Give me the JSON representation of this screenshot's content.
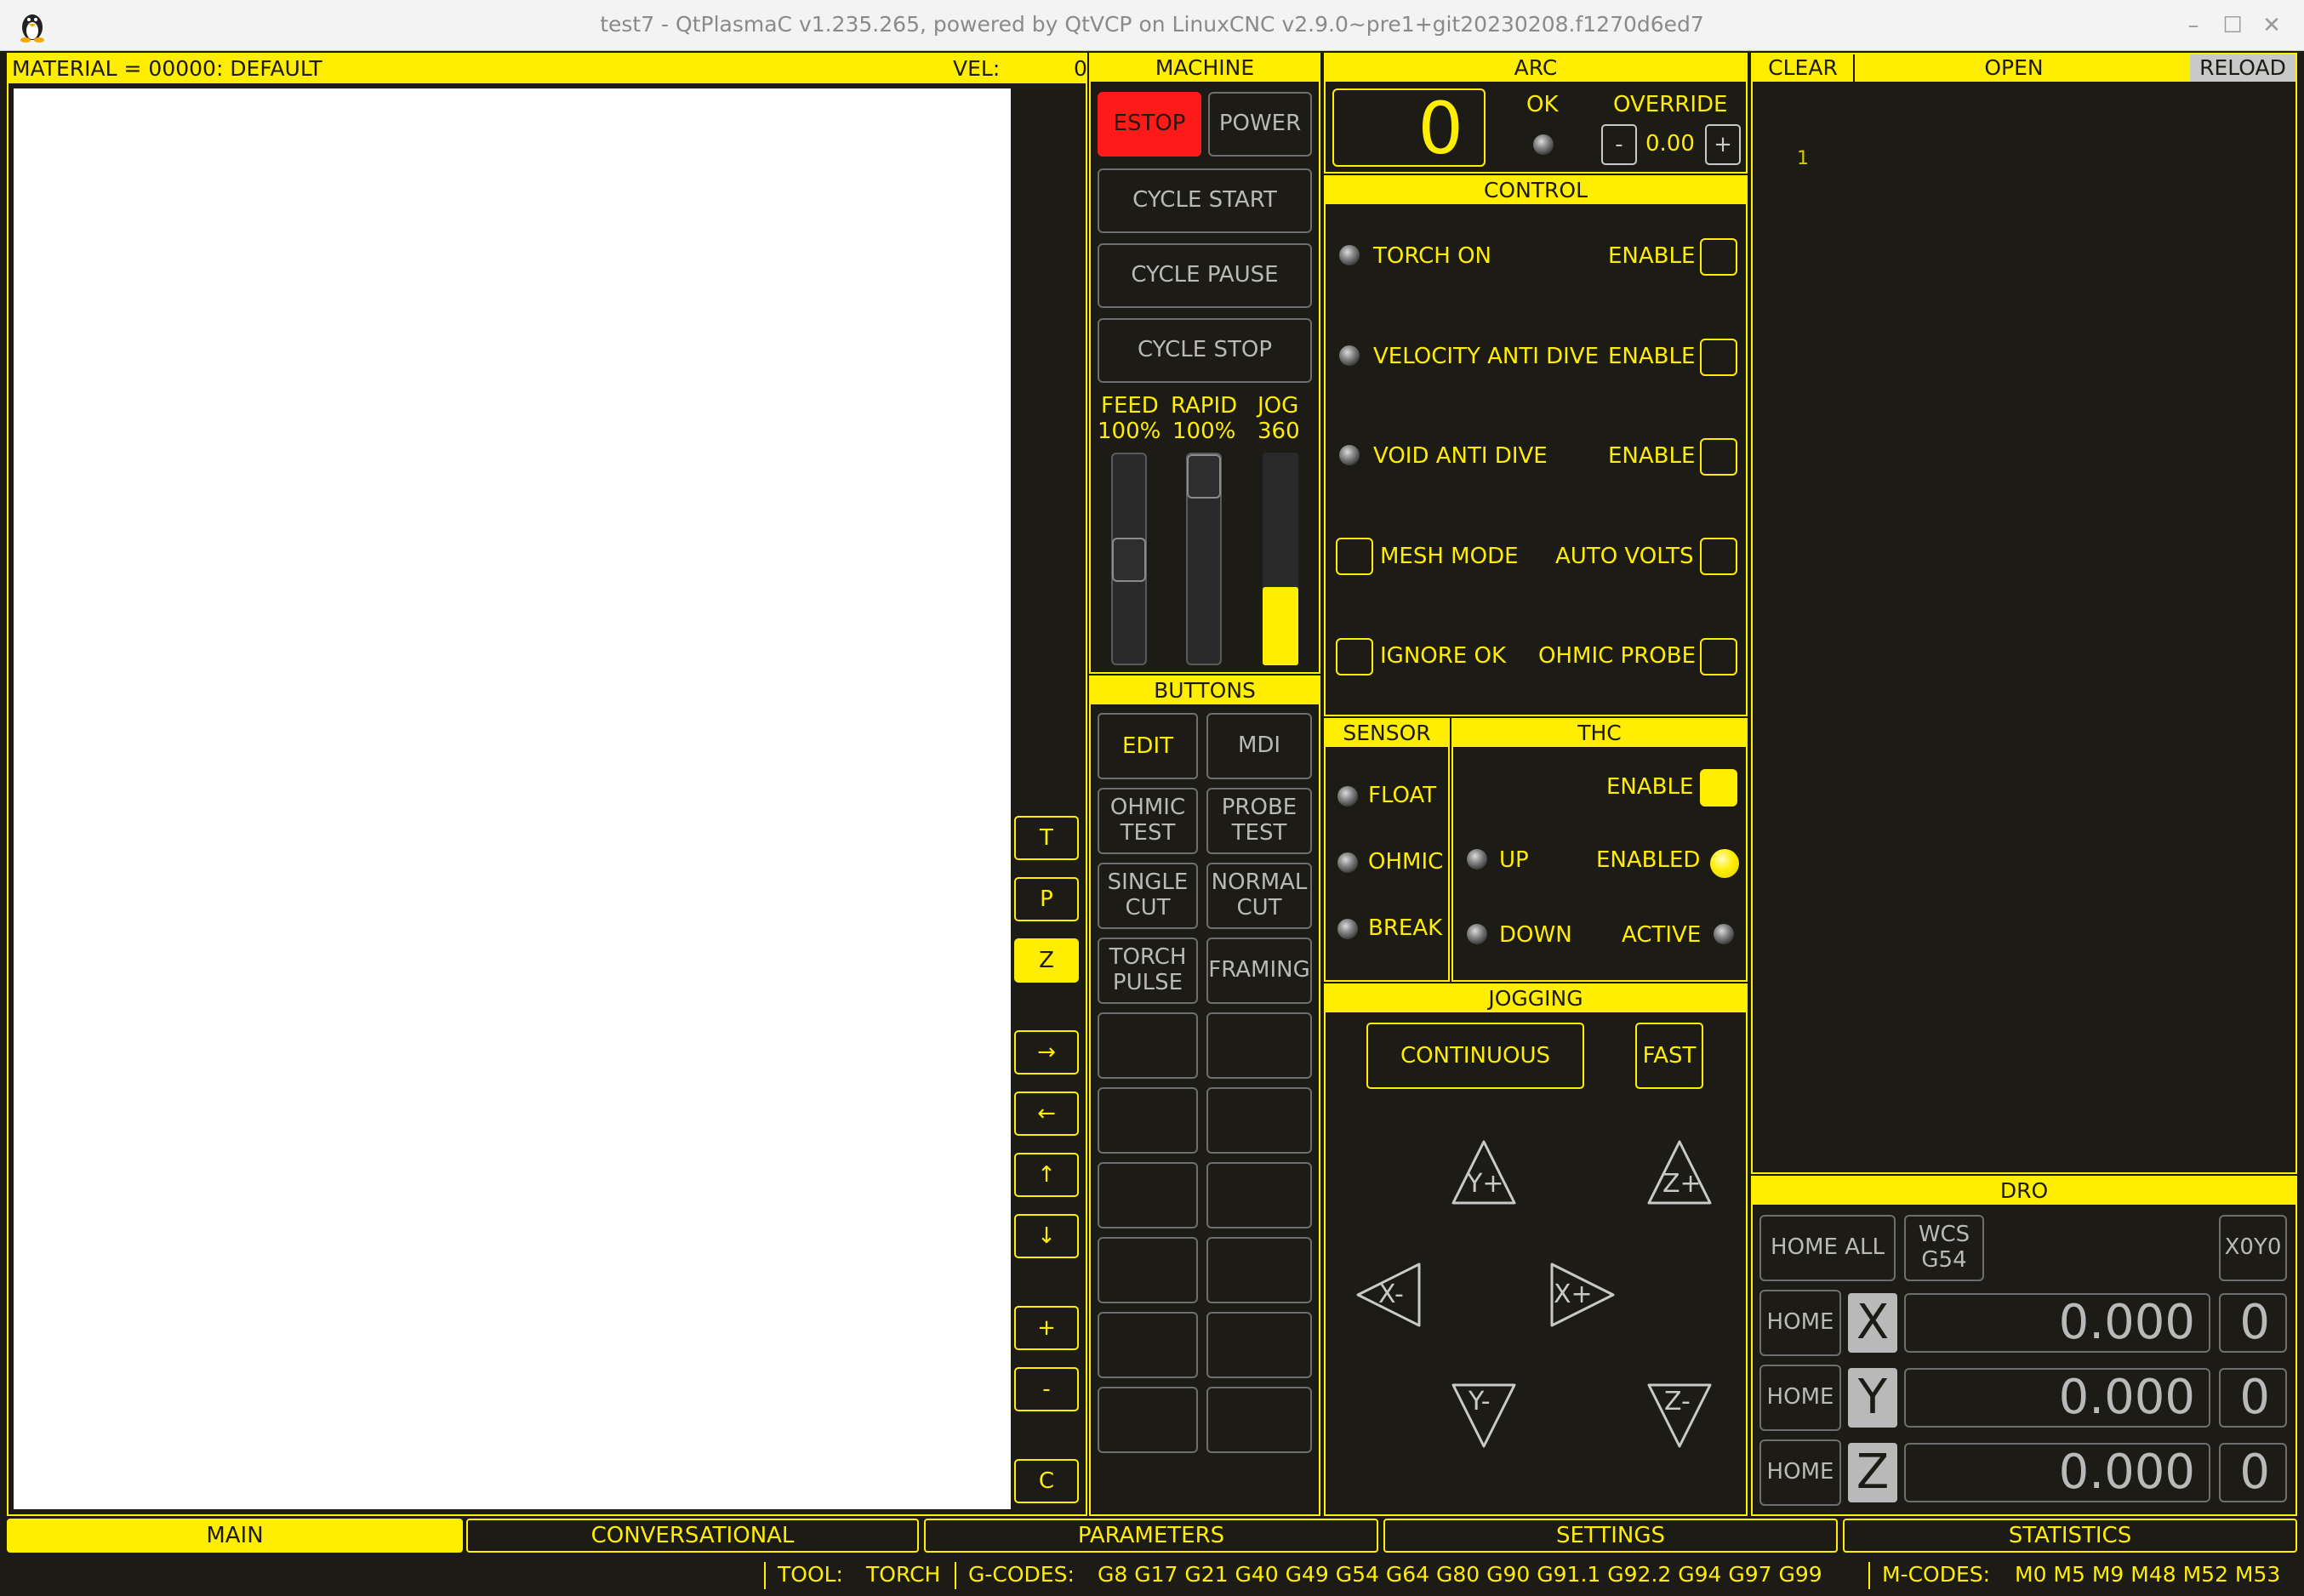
{
  "window": {
    "title": "test7 - QtPlasmaC v1.235.265, powered by QtVCP on LinuxCNC v2.9.0~pre1+git20230208.f1270d6ed7"
  },
  "preview": {
    "material_label": "MATERIAL =  00000: DEFAULT",
    "vel_label": "VEL:",
    "vel_value": "0",
    "view_buttons": [
      "T",
      "P",
      "Z",
      "→",
      "←",
      "↑",
      "↓",
      "+",
      "-",
      "C"
    ]
  },
  "machine": {
    "header": "MACHINE",
    "estop": "ESTOP",
    "power": "POWER",
    "cycle_start": "CYCLE START",
    "cycle_pause": "CYCLE PAUSE",
    "cycle_stop": "CYCLE STOP",
    "feed_label": "FEED",
    "feed_value": "100%",
    "rapid_label": "RAPID",
    "rapid_value": "100%",
    "jog_label": "JOG",
    "jog_value": "360"
  },
  "arc": {
    "header": "ARC",
    "voltage": "0",
    "ok_label": "OK",
    "override_label": "OVERRIDE",
    "minus": "-",
    "override_value": "0.00",
    "plus": "+"
  },
  "control": {
    "header": "CONTROL",
    "torch_on": "TORCH ON",
    "vad": "VELOCITY ANTI DIVE",
    "void": "VOID ANTI DIVE",
    "enable": "ENABLE",
    "mesh_mode": "MESH MODE",
    "auto_volts": "AUTO VOLTS",
    "ignore_ok": "IGNORE OK",
    "ohmic_probe": "OHMIC PROBE"
  },
  "buttons": {
    "header": "BUTTONS",
    "edit": "EDIT",
    "mdi": "MDI",
    "ohmic_test": "OHMIC\nTEST",
    "probe_test": "PROBE\nTEST",
    "single_cut": "SINGLE\nCUT",
    "normal_cut": "NORMAL\nCUT",
    "torch_pulse": "TORCH\nPULSE",
    "framing": "FRAMING"
  },
  "sensor": {
    "header": "SENSOR",
    "float": "FLOAT",
    "ohmic": "OHMIC",
    "break": "BREAK"
  },
  "thc": {
    "header": "THC",
    "enable": "ENABLE",
    "up": "UP",
    "enabled": "ENABLED",
    "down": "DOWN",
    "active": "ACTIVE"
  },
  "jogging": {
    "header": "JOGGING",
    "mode": "CONTINUOUS",
    "fast": "FAST",
    "yplus": "Y+",
    "zplus": "Z+",
    "xminus": "X-",
    "xplus": "X+",
    "yminus": "Y-",
    "zminus": "Z-"
  },
  "gcode": {
    "clear": "CLEAR",
    "open": "OPEN",
    "reload": "RELOAD",
    "line1": "1"
  },
  "dro": {
    "header": "DRO",
    "home_all": "HOME ALL",
    "wcs": "WCS\nG54",
    "x0y0": "X0Y0",
    "home": "HOME",
    "axes": [
      {
        "name": "X",
        "value": "0.000",
        "home_state": "0"
      },
      {
        "name": "Y",
        "value": "0.000",
        "home_state": "0"
      },
      {
        "name": "Z",
        "value": "0.000",
        "home_state": "0"
      }
    ]
  },
  "tabs": [
    "MAIN",
    "CONVERSATIONAL",
    "PARAMETERS",
    "SETTINGS",
    "STATISTICS"
  ],
  "status": {
    "tool_label": "TOOL:",
    "tool_value": "TORCH",
    "gcodes_label": "G-CODES:",
    "gcodes_value": "G8 G17 G21 G40 G49 G54 G64 G80 G90 G91.1 G92.2 G94 G97 G99",
    "mcodes_label": "M-CODES:",
    "mcodes_value": "M0 M5 M9 M48 M52 M53"
  },
  "colors": {
    "accent": "#ffee00",
    "background": "#1c1b16",
    "estop": "#ff1a1a"
  }
}
